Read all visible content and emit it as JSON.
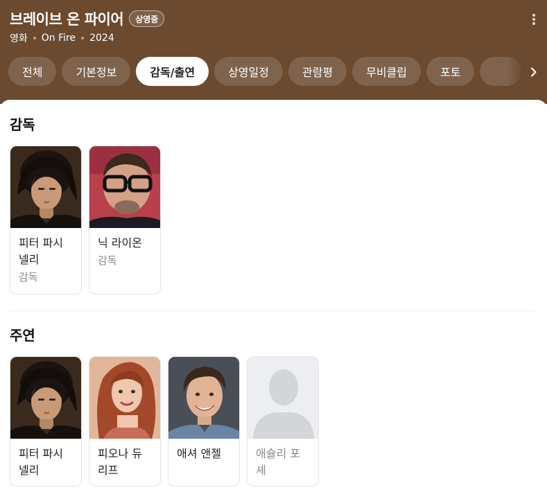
{
  "header": {
    "title": "브레이브 온 파이어",
    "badge": "상영중",
    "meta": [
      "영화",
      "On Fire",
      "2024"
    ],
    "bg_color": "#6b4a30"
  },
  "tabs": [
    {
      "label": "전체",
      "active": false
    },
    {
      "label": "기본정보",
      "active": false
    },
    {
      "label": "감독/출연",
      "active": true
    },
    {
      "label": "상영일정",
      "active": false
    },
    {
      "label": "관람평",
      "active": false
    },
    {
      "label": "무비클립",
      "active": false
    },
    {
      "label": "포토",
      "active": false
    },
    {
      "label": "",
      "active": false
    }
  ],
  "sections": {
    "director": {
      "title": "감독",
      "people": [
        {
          "name": "피터 파시 넬리",
          "role": "감독",
          "photo": "actor-1"
        },
        {
          "name": "닉 라이온",
          "role": "감독",
          "photo": "actor-2"
        }
      ]
    },
    "cast": {
      "title": "주연",
      "people": [
        {
          "name": "피터 파시 넬리",
          "photo": "actor-1"
        },
        {
          "name": "피오나 듀리프",
          "photo": "actor-3"
        },
        {
          "name": "애셔 앤젤",
          "photo": "actor-4"
        },
        {
          "name": "애슐리 포셰",
          "photo": "placeholder-silhouette-icon"
        }
      ]
    }
  },
  "icons": {
    "more": "kebab-menu-icon",
    "next": "chevron-right-icon"
  }
}
